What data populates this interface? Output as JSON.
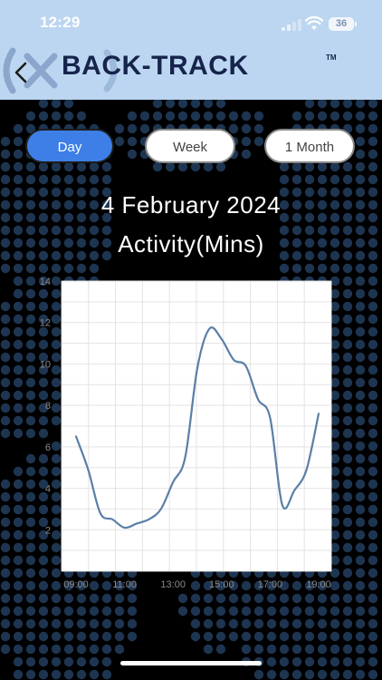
{
  "status_bar": {
    "time": "12:29",
    "battery": "36"
  },
  "nav": {
    "brand": "BACK-TRACK",
    "trademark": "TM"
  },
  "tabs": [
    {
      "label": "Day",
      "selected": true
    },
    {
      "label": "Week",
      "selected": false
    },
    {
      "label": "1 Month",
      "selected": false
    }
  ],
  "page": {
    "date": "4 February 2024",
    "metric": "Activity(Mins)"
  },
  "colors": {
    "header_bg": "#bcd6f1",
    "accent": "#3d7fe6",
    "line": "#5b7fa6",
    "brand": "#16244c"
  },
  "chart_data": {
    "type": "line",
    "x": [
      "09:00",
      "09:30",
      "10:00",
      "10:30",
      "11:00",
      "11:30",
      "12:00",
      "12:30",
      "13:00",
      "13:30",
      "14:00",
      "14:30",
      "15:00",
      "15:30",
      "16:00",
      "16:30",
      "17:00",
      "17:30",
      "18:00",
      "18:30",
      "19:00"
    ],
    "x_tick_labels": [
      "09:00",
      "11:00",
      "13:00",
      "15:00",
      "17:00",
      "19:00"
    ],
    "series": [
      {
        "values": [
          6.5,
          4.9,
          2.8,
          2.5,
          2.1,
          2.3,
          2.5,
          3.0,
          4.3,
          5.5,
          9.8,
          11.7,
          11.2,
          10.2,
          9.9,
          8.3,
          7.4,
          3.2,
          3.9,
          4.9,
          7.6
        ]
      }
    ],
    "y_ticks": [
      2,
      4,
      6,
      8,
      10,
      12,
      14
    ],
    "ylim": [
      0,
      14
    ],
    "grid": true
  }
}
